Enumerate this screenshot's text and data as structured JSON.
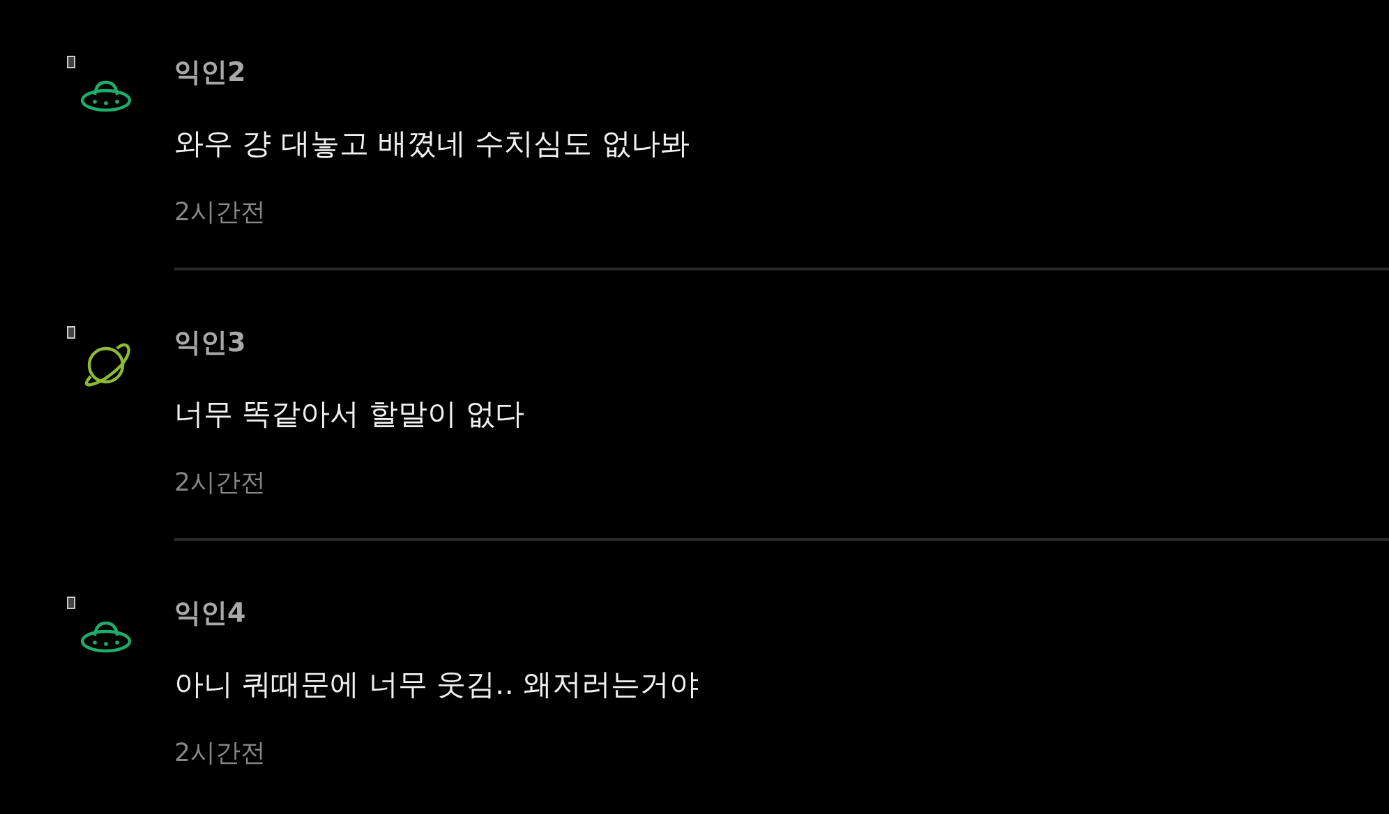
{
  "comments": [
    {
      "avatar": {
        "kind": "ufo",
        "color": "#1fae6a"
      },
      "author": "익인2",
      "text": "와우 걍 대놓고 배꼈네 수치심도 없나봐",
      "time": "2시간전"
    },
    {
      "avatar": {
        "kind": "planet",
        "color": "#8dbb35"
      },
      "author": "익인3",
      "text": "너무 똑같아서 할말이 없다",
      "time": "2시간전"
    },
    {
      "avatar": {
        "kind": "ufo",
        "color": "#1fae6a"
      },
      "author": "익인4",
      "text": "아니 쿼때문에 너무 웃김.. 왜저러는거야",
      "time": "2시간전"
    }
  ]
}
